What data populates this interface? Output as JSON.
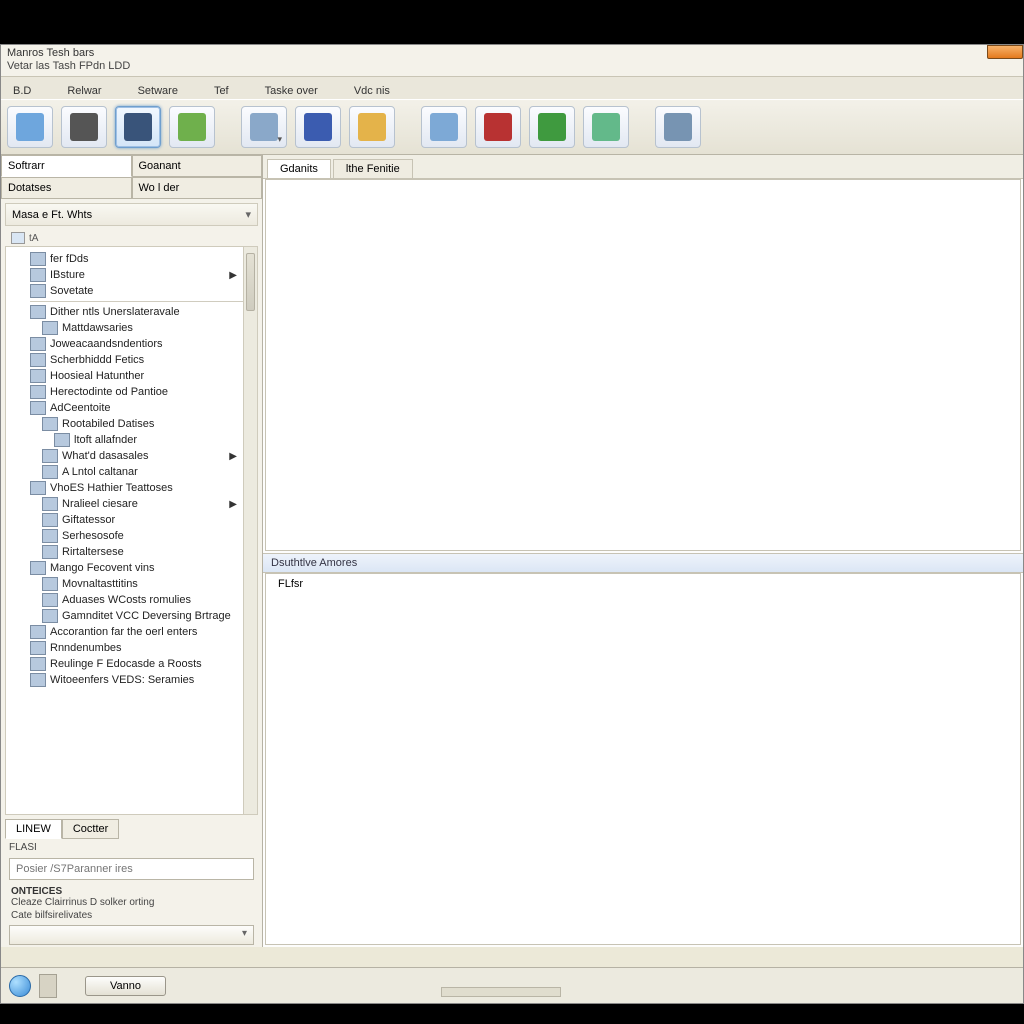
{
  "window": {
    "title": "Manros Tesh bars",
    "menubar": "Vetar  las   Tash   FPdn  LDD"
  },
  "tabstrip": [
    "B.D",
    "Relwar",
    "Setware",
    "Tef",
    "Taske over",
    "Vdc nis"
  ],
  "toolbar": [
    {
      "name": "tool-1",
      "color": "#6ea6dd"
    },
    {
      "name": "tool-2",
      "color": "#555"
    },
    {
      "name": "tool-3",
      "color": "#39547a",
      "selected": true
    },
    {
      "name": "tool-4",
      "color": "#6fb04c"
    },
    {
      "name": "tool-5",
      "color": "#8aa8c9",
      "drop": true
    },
    {
      "name": "tool-6",
      "color": "#3b5cb0"
    },
    {
      "name": "tool-7",
      "color": "#e4b34a"
    },
    {
      "name": "tool-8",
      "color": "#7da9d6"
    },
    {
      "name": "tool-9",
      "color": "#b83232"
    },
    {
      "name": "tool-10",
      "color": "#3f9a3f"
    },
    {
      "name": "tool-11",
      "color": "#63b98a"
    },
    {
      "name": "tool-12",
      "color": "#7794b2"
    }
  ],
  "sidebar": {
    "tabs_row1": [
      "Softrarr",
      "Goanant"
    ],
    "tabs_row2": [
      "Dotatses",
      "Wo l der"
    ],
    "panel_header": "Masa  e  Ft.  Whts",
    "panel_sub": "tA",
    "tree": [
      {
        "label": "fer fDds",
        "indent": 1
      },
      {
        "label": "IBsture",
        "indent": 1,
        "arrow": true
      },
      {
        "label": "Sovetate",
        "indent": 1
      },
      {
        "hr": true
      },
      {
        "label": "Dither ntls Unerslateravale",
        "indent": 1
      },
      {
        "label": "Mattdawsaries",
        "indent": 2
      },
      {
        "label": "Joweacaandsndentiors",
        "indent": 1
      },
      {
        "label": "Scherbhiddd Fetics",
        "indent": 1
      },
      {
        "label": "Hoosieal Hatunther",
        "indent": 1
      },
      {
        "label": "Herectodinte od Pantioe",
        "indent": 1
      },
      {
        "label": "AdCeentoite",
        "indent": 1
      },
      {
        "label": "Rootabiled Datises",
        "indent": 2
      },
      {
        "label": "ltoft allafnder",
        "indent": 3
      },
      {
        "label": "What'd dasasales",
        "indent": 2,
        "arrow": true
      },
      {
        "label": "A Lntol caltanar",
        "indent": 2
      },
      {
        "label": "VhoES Hathier Teattoses",
        "indent": 1
      },
      {
        "label": "Nralieel ciesare",
        "indent": 2,
        "arrow": true
      },
      {
        "label": "Giftatessor",
        "indent": 2
      },
      {
        "label": "Serhesosofe",
        "indent": 2
      },
      {
        "label": "Rirtaltersese",
        "indent": 2
      },
      {
        "label": "Mango Fecovent vins",
        "indent": 1
      },
      {
        "label": "Movnaltasttitins",
        "indent": 2
      },
      {
        "label": "Aduases WCosts romulies",
        "indent": 2
      },
      {
        "label": "Gamnditet VCC Deversing Brtrage",
        "indent": 2
      },
      {
        "label": "Accorantion far the oerl enters",
        "indent": 1
      },
      {
        "label": "Rnndenumbes",
        "indent": 1
      },
      {
        "label": "Reulinge F Edocasde a Roosts",
        "indent": 1
      },
      {
        "label": "Witoeenfers VEDS: Seramies",
        "indent": 1
      }
    ],
    "lower_tabs": [
      "LINEW",
      "Coctter"
    ],
    "lower": {
      "label1": "FLASI",
      "input1_placeholder": "Posier /S7Paranner ires",
      "section": "ONTEICES",
      "line1": "Cleaze Clairrinus D solker orting",
      "line2": "Cate bilfsirelivates"
    }
  },
  "main": {
    "tabs": [
      "Gdanits",
      "lthe Fenitie"
    ],
    "split_header": "Dsuthtlve  Amores",
    "detail_label": "FLfsr"
  },
  "statusbar": {
    "button": "Vanno"
  }
}
